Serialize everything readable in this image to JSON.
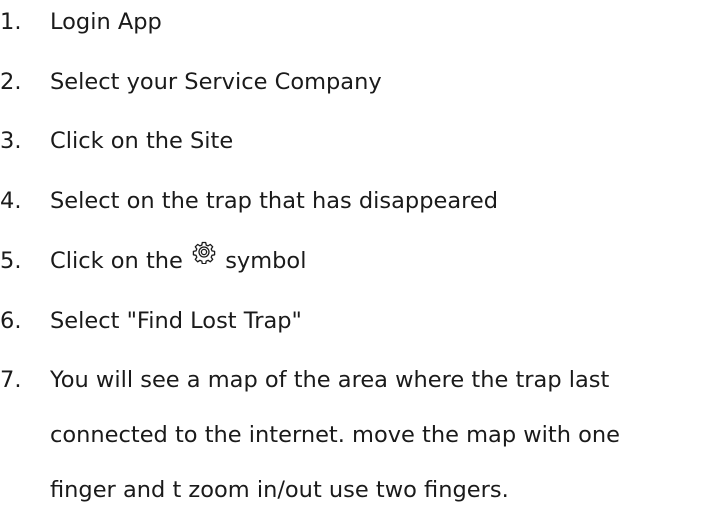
{
  "steps": [
    {
      "number": "1.",
      "text": "Login App"
    },
    {
      "number": "2.",
      "text": "Select your Service Company"
    },
    {
      "number": "3.",
      "text": "Click on the Site"
    },
    {
      "number": "4.",
      "text": "Select on the trap that has disappeared"
    },
    {
      "number": "5.",
      "text_before": "Click on the",
      "icon": "gear-icon",
      "text_after": "symbol"
    },
    {
      "number": "6.",
      "text": "Select \"Find Lost Trap\""
    },
    {
      "number": "7.",
      "lines": [
        "You will see a map of the area where the trap last",
        "connected to the internet. move the map with one",
        "finger and t zoom in/out use two fingers."
      ]
    }
  ]
}
